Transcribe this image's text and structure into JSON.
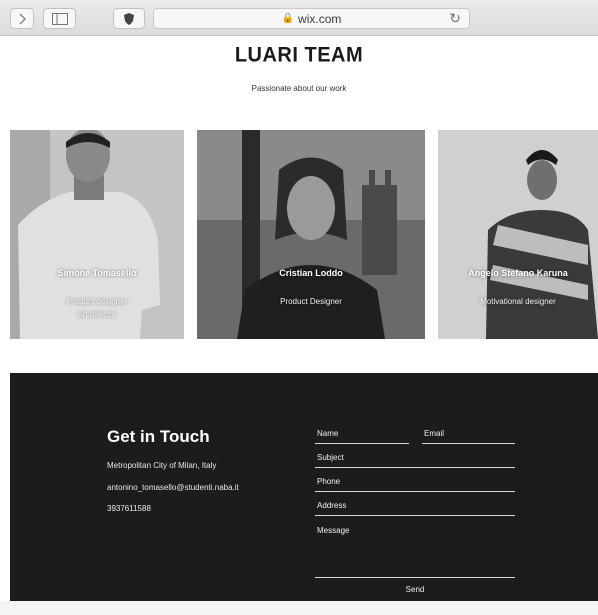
{
  "browser": {
    "url": "wix.com",
    "icons": [
      "chevron-right-icon",
      "sidebar-icon",
      "shield-icon",
      "lock-icon",
      "reload-icon"
    ]
  },
  "header": {
    "title": "LUARI TEAM",
    "subtitle": "Passionate about our work"
  },
  "team": [
    {
      "name": "Simone Tomasello",
      "role_line1": "Product designer",
      "role_line2": "Art director"
    },
    {
      "name": "Cristian Loddo",
      "role_line1": "Product Designer",
      "role_line2": ""
    },
    {
      "name": "Angelo Stefano Karuna",
      "role_line1": "Motivational designer",
      "role_line2": ""
    }
  ],
  "contact": {
    "heading": "Get in Touch",
    "address": "Metropolitan City of Milan, Italy",
    "email": "antonino_tomasello@studenti.naba.it",
    "phone": "3937611588",
    "form": {
      "name": "Name",
      "email": "Email",
      "subject": "Subject",
      "phone": "Phone",
      "address": "Address",
      "message": "Message",
      "send": "Send"
    }
  },
  "colors": {
    "footer_bg": "#1c1c1c",
    "accent_text": "#ffffff"
  }
}
